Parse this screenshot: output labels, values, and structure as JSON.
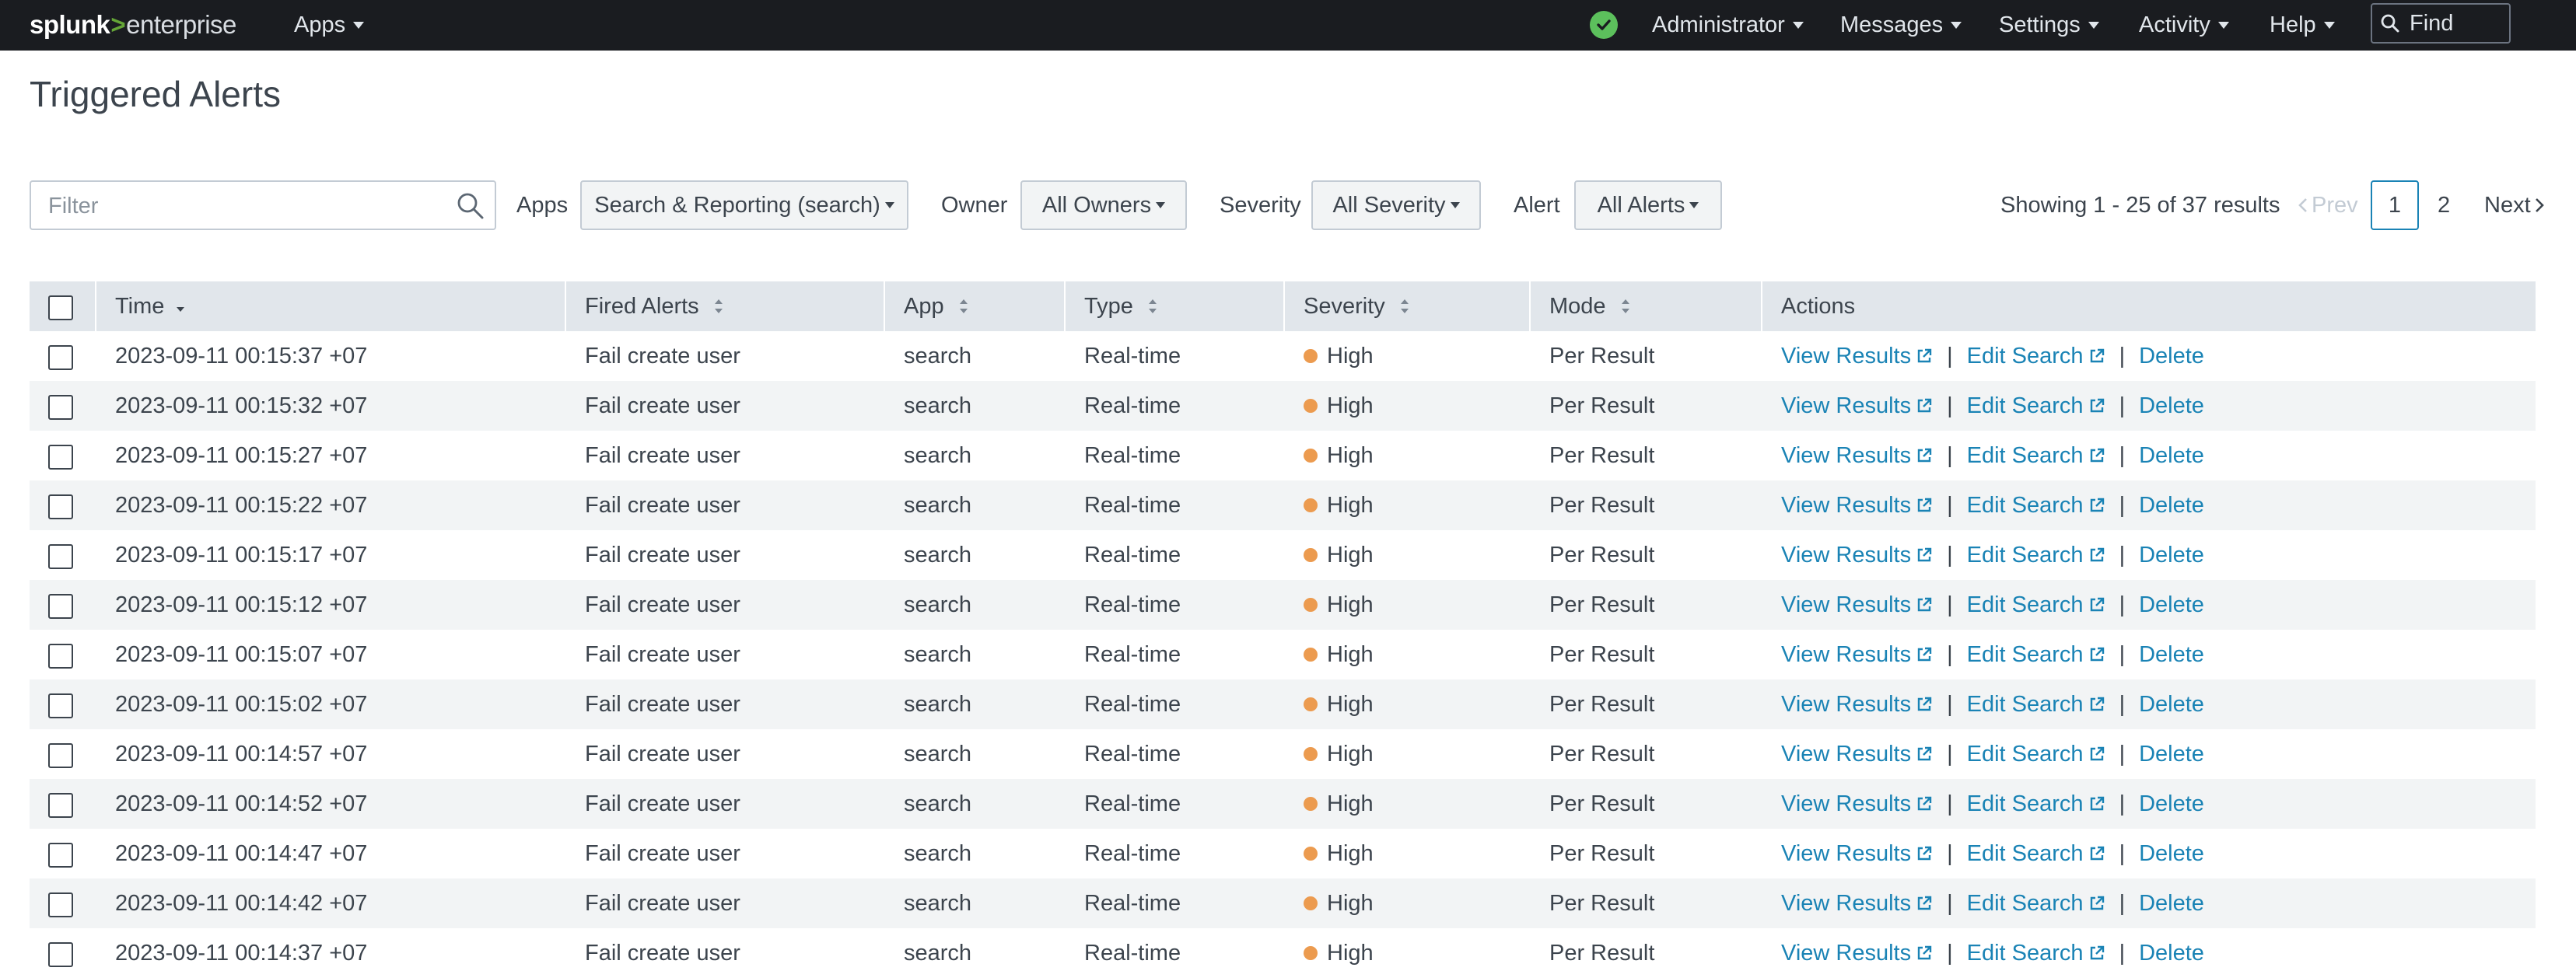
{
  "nav": {
    "logo_part1": "splunk",
    "logo_part2": ">",
    "logo_part3": "enterprise",
    "apps": "Apps",
    "user": "Administrator",
    "messages": "Messages",
    "settings": "Settings",
    "activity": "Activity",
    "help": "Help",
    "find_placeholder": "Find"
  },
  "page": {
    "title": "Triggered Alerts"
  },
  "filters": {
    "filter_placeholder": "Filter",
    "apps_label": "Apps",
    "apps_value": "Search & Reporting (search)",
    "owner_label": "Owner",
    "owner_value": "All Owners",
    "severity_label": "Severity",
    "severity_value": "All Severity",
    "alert_label": "Alert",
    "alert_value": "All Alerts"
  },
  "pagination": {
    "showing": "Showing 1 - 25 of 37 results",
    "prev": "Prev",
    "page1": "1",
    "page2": "2",
    "next": "Next"
  },
  "table": {
    "headers": {
      "time": "Time",
      "fired_alerts": "Fired Alerts",
      "app": "App",
      "type": "Type",
      "severity": "Severity",
      "mode": "Mode",
      "actions": "Actions"
    },
    "actions": {
      "view": "View Results",
      "edit": "Edit Search",
      "delete": "Delete",
      "separator": "|"
    },
    "rows": [
      {
        "time": "2023-09-11 00:15:37 +07",
        "alert": "Fail create user",
        "app": "search",
        "type": "Real-time",
        "severity": "High",
        "mode": "Per Result"
      },
      {
        "time": "2023-09-11 00:15:32 +07",
        "alert": "Fail create user",
        "app": "search",
        "type": "Real-time",
        "severity": "High",
        "mode": "Per Result"
      },
      {
        "time": "2023-09-11 00:15:27 +07",
        "alert": "Fail create user",
        "app": "search",
        "type": "Real-time",
        "severity": "High",
        "mode": "Per Result"
      },
      {
        "time": "2023-09-11 00:15:22 +07",
        "alert": "Fail create user",
        "app": "search",
        "type": "Real-time",
        "severity": "High",
        "mode": "Per Result"
      },
      {
        "time": "2023-09-11 00:15:17 +07",
        "alert": "Fail create user",
        "app": "search",
        "type": "Real-time",
        "severity": "High",
        "mode": "Per Result"
      },
      {
        "time": "2023-09-11 00:15:12 +07",
        "alert": "Fail create user",
        "app": "search",
        "type": "Real-time",
        "severity": "High",
        "mode": "Per Result"
      },
      {
        "time": "2023-09-11 00:15:07 +07",
        "alert": "Fail create user",
        "app": "search",
        "type": "Real-time",
        "severity": "High",
        "mode": "Per Result"
      },
      {
        "time": "2023-09-11 00:15:02 +07",
        "alert": "Fail create user",
        "app": "search",
        "type": "Real-time",
        "severity": "High",
        "mode": "Per Result"
      },
      {
        "time": "2023-09-11 00:14:57 +07",
        "alert": "Fail create user",
        "app": "search",
        "type": "Real-time",
        "severity": "High",
        "mode": "Per Result"
      },
      {
        "time": "2023-09-11 00:14:52 +07",
        "alert": "Fail create user",
        "app": "search",
        "type": "Real-time",
        "severity": "High",
        "mode": "Per Result"
      },
      {
        "time": "2023-09-11 00:14:47 +07",
        "alert": "Fail create user",
        "app": "search",
        "type": "Real-time",
        "severity": "High",
        "mode": "Per Result"
      },
      {
        "time": "2023-09-11 00:14:42 +07",
        "alert": "Fail create user",
        "app": "search",
        "type": "Real-time",
        "severity": "High",
        "mode": "Per Result"
      },
      {
        "time": "2023-09-11 00:14:37 +07",
        "alert": "Fail create user",
        "app": "search",
        "type": "Real-time",
        "severity": "High",
        "mode": "Per Result"
      }
    ]
  },
  "colors": {
    "nav_bg": "#1a1c20",
    "brand_green": "#65a637",
    "link_blue": "#1a83b5",
    "severity_high": "#ec9b4f",
    "header_bg": "#e1e6eb",
    "row_alt_bg": "#f2f4f5"
  }
}
